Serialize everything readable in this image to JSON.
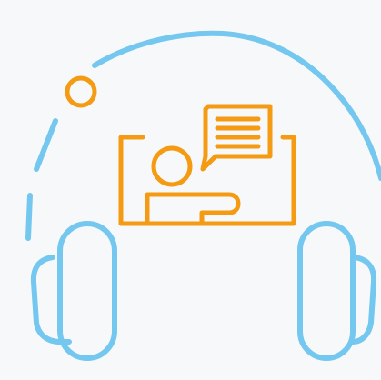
{
  "illustration": {
    "icon": "headphones-online-lesson-icon",
    "colors": {
      "background": "#f7f8fa",
      "headphones": "#74c7ee",
      "lesson": "#f49a13"
    }
  }
}
